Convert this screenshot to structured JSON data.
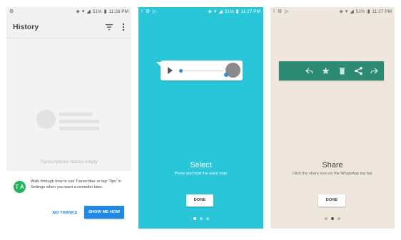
{
  "screens": [
    {
      "status": {
        "battery": "51%",
        "time": "11:26 PM"
      },
      "appbar": {
        "title": "History",
        "icons": [
          "filter-icon",
          "more-vert-icon"
        ]
      },
      "empty_text": "Transcriptions history empty",
      "tip": {
        "avatar_text": "T A",
        "text": "Walk through how to use Transcriber or tap 'Tips' in Settings when you want a reminder later."
      },
      "buttons": {
        "no_thanks": "NO THANKS",
        "show_me_how": "SHOW ME HOW"
      }
    },
    {
      "status": {
        "battery": "51%",
        "time": "11:27 PM"
      },
      "title": "Select",
      "subtitle": "Press and hold the voice note",
      "done": "DONE",
      "active_dot": 0
    },
    {
      "status": {
        "battery": "51%",
        "time": "11:27 PM"
      },
      "title": "Share",
      "subtitle": "Click the share icon on the WhatsApp top bar",
      "done": "DONE",
      "active_dot": 1,
      "toolbar_icons": [
        "reply-icon",
        "star-icon",
        "delete-icon",
        "share-icon",
        "forward-icon"
      ]
    }
  ],
  "colors": {
    "accent_blue": "#1e88e5",
    "teal_bg": "#29c6d9",
    "beige_bg": "#efe6dd",
    "whatsapp_green": "#2e8b73"
  }
}
